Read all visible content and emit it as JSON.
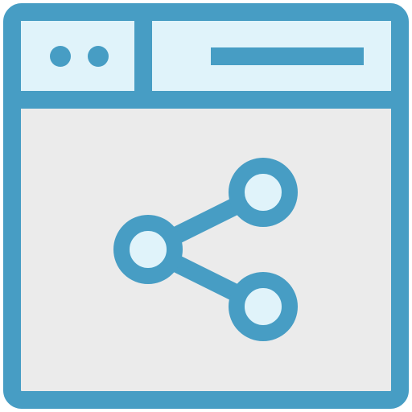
{
  "icon": {
    "name": "browser-window-share-icon",
    "parts": [
      "window-frame",
      "titlebar",
      "window-controls",
      "address-bar",
      "content-area",
      "share-icon"
    ]
  },
  "colors": {
    "stroke": "#479DC4",
    "titlebar_fill": "#E0F3FA",
    "content_fill": "#EBEBEB",
    "node_fill": "#E0F3FA",
    "background": "#FFFFFF"
  }
}
